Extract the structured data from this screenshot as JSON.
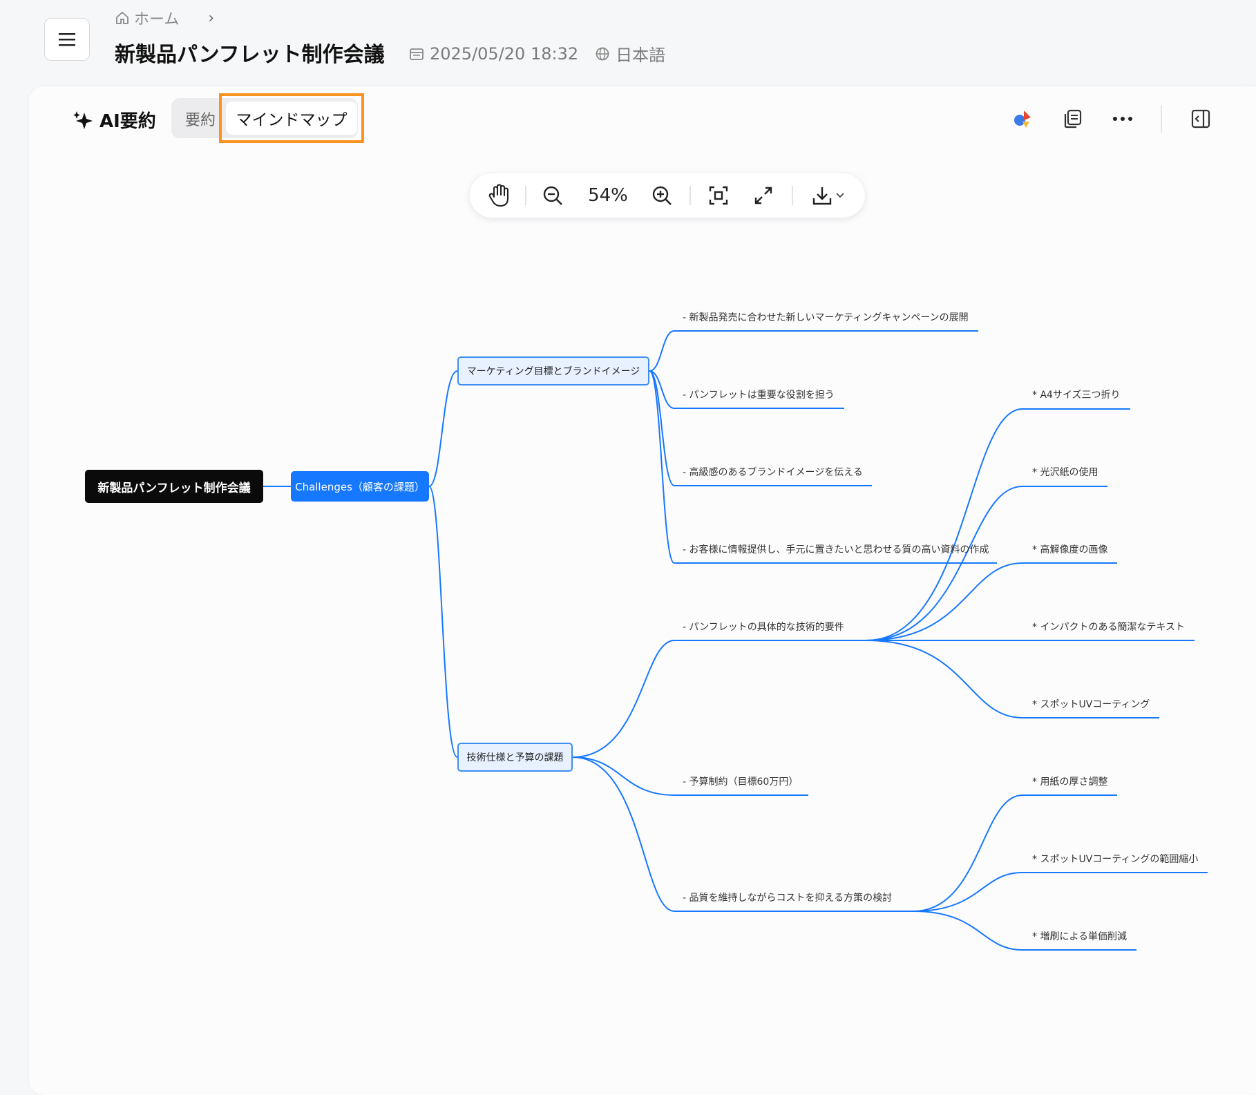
{
  "breadcrumb": {
    "home": "ホーム"
  },
  "header": {
    "title": "新製品パンフレット制作会議",
    "datetime": "2025/05/20 18:32",
    "language": "日本語"
  },
  "panel": {
    "ai_label": "AI要約",
    "tabs": {
      "summary": "要約",
      "mindmap": "マインドマップ"
    }
  },
  "toolbar": {
    "zoom": "54%"
  },
  "colors": {
    "accent": "#1677ff",
    "highlight": "#f7931e",
    "line": "#1677ff"
  },
  "mindmap": {
    "root": "新製品パンフレット制作会議",
    "level1": "Challenges（顧客の課題）",
    "branch_a": {
      "label": "マーケティング目標とブランドイメージ",
      "items": [
        "- 新製品発売に合わせた新しいマーケティングキャンペーンの展開",
        "- パンフレットは重要な役割を担う",
        "- 高級感のあるブランドイメージを伝える",
        "- お客様に情報提供し、手元に置きたいと思わせる質の高い資料の作成"
      ]
    },
    "branch_b": {
      "label": "技術仕様と予算の課題",
      "items": [
        "- パンフレットの具体的な技術的要件",
        "- 予算制約（目標60万円）",
        "- 品質を維持しながらコストを抑える方策の検討"
      ],
      "tech_subitems": [
        "* A4サイズ三つ折り",
        "* 光沢紙の使用",
        "* 高解像度の画像",
        "* インパクトのある簡潔なテキスト",
        "* スポットUVコーティング"
      ],
      "cost_subitems": [
        "* 用紙の厚さ調整",
        "* スポットUVコーティングの範囲縮小",
        "* 増刷による単価削減"
      ]
    }
  }
}
